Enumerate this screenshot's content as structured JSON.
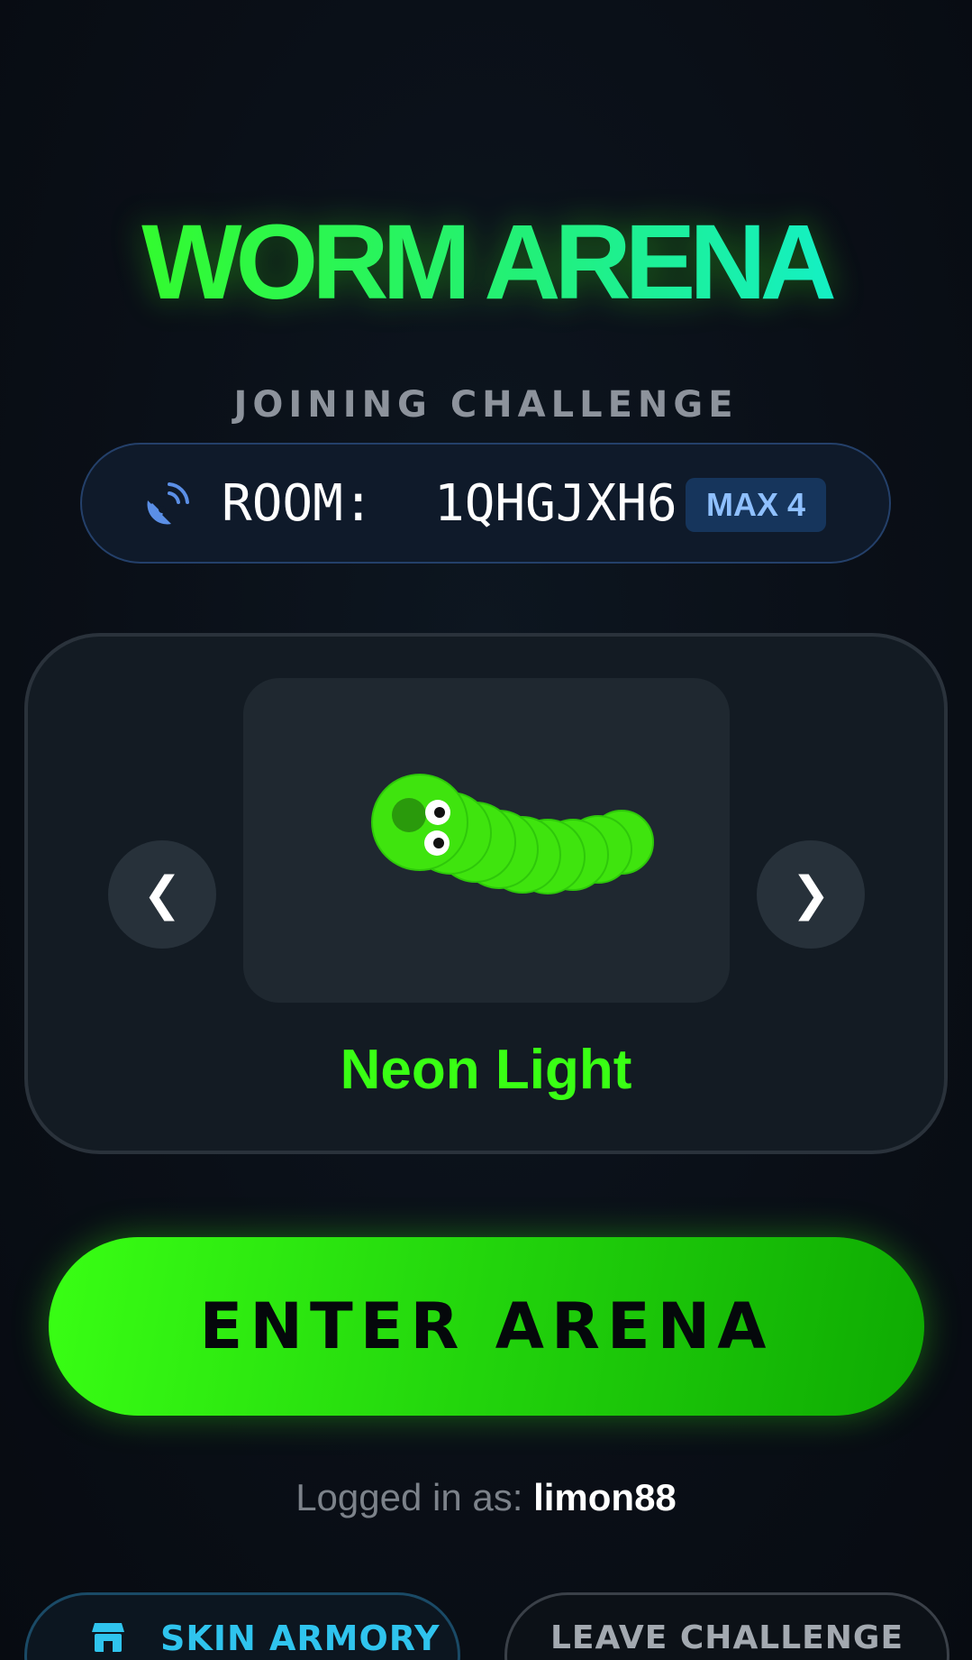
{
  "header": {
    "title": "WORM ARENA",
    "subtitle": "JOINING CHALLENGE"
  },
  "room": {
    "icon": "satellite-dish-icon",
    "label": "ROOM:  1QHGJXH6",
    "max_badge": "MAX 4"
  },
  "skin_selector": {
    "prev_label": "❮",
    "next_label": "❯",
    "skin_name": "Neon Light",
    "skin_color": "#39ff14"
  },
  "actions": {
    "enter_label": "ENTER ARENA",
    "armory_icon": "store-icon",
    "armory_label": "SKIN ARMORY",
    "leave_label": "LEAVE CHALLENGE"
  },
  "session": {
    "logged_in_prefix": "Logged in as: ",
    "username": "limon88"
  },
  "colors": {
    "accent": "#39ff14",
    "background": "#0a0f17",
    "armory": "#2fc4ee"
  }
}
